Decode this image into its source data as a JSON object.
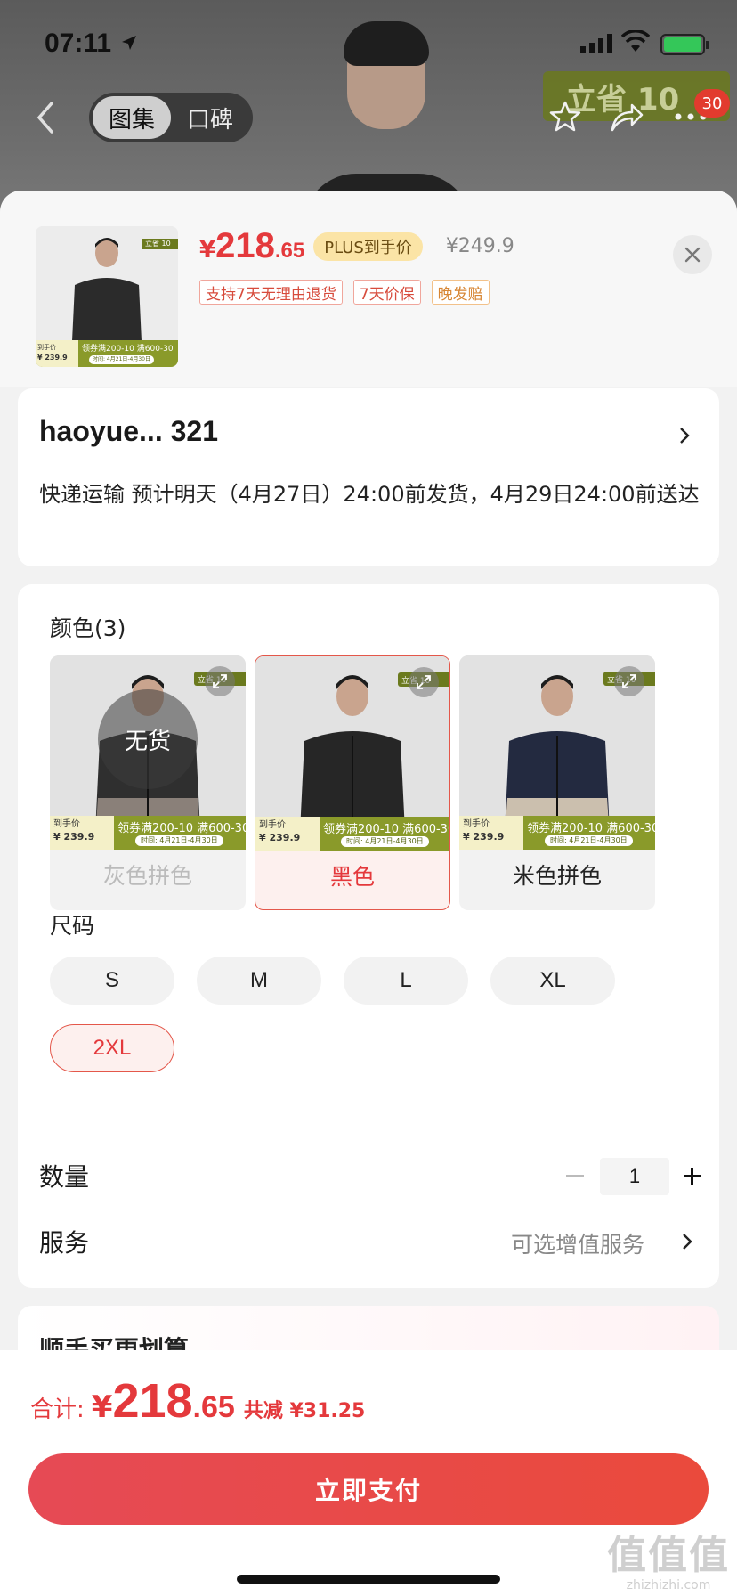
{
  "status_bar": {
    "time": "07:11"
  },
  "nav": {
    "tabs": [
      {
        "label": "图集",
        "active": true
      },
      {
        "label": "口碑",
        "active": false
      }
    ],
    "promo_badge": "立省 10",
    "notification_count": "30"
  },
  "product": {
    "thumb_price_label": "到手价",
    "thumb_price": "¥ 239.9",
    "thumb_coupon": "领券满200-10 满600-30",
    "thumb_coupon_sub": "时间: 4月21日-4月30日",
    "thumb_badge": "立省 10",
    "price_symbol": "¥",
    "price_int": "218",
    "price_dec": ".65",
    "plus_tag": "PLUS到手价",
    "original_price": "¥249.9",
    "service_tags": [
      {
        "label": "支持7天无理由退货",
        "style": "red"
      },
      {
        "label": "7天价保",
        "style": "red"
      },
      {
        "label": "晚发赔",
        "style": "orange"
      }
    ]
  },
  "address": {
    "name": "haoyue...  321",
    "shipping": "快递运输 预计明天（4月27日）24:00前发货，4月29日24:00前送达"
  },
  "color_section": {
    "title": "颜色(3)",
    "options": [
      {
        "label": "灰色拼色",
        "state": "disabled",
        "overlay": "无货",
        "jacket": "#2f2f2f",
        "lower": "#8a8079"
      },
      {
        "label": "黑色",
        "state": "selected",
        "overlay": "",
        "jacket": "#262626",
        "lower": "#262626"
      },
      {
        "label": "米色拼色",
        "state": "normal",
        "overlay": "",
        "jacket": "#232a40",
        "lower": "#cbbfae"
      }
    ],
    "badge": "立省 10",
    "price_label": "到手价",
    "price": "¥ 239.9",
    "coupon": "领券满200-10 满600-30",
    "coupon_sub": "时间: 4月21日-4月30日"
  },
  "size_section": {
    "title": "尺码",
    "options": [
      {
        "label": "S",
        "selected": false
      },
      {
        "label": "M",
        "selected": false
      },
      {
        "label": "L",
        "selected": false
      },
      {
        "label": "XL",
        "selected": false
      },
      {
        "label": "2XL",
        "selected": true
      }
    ]
  },
  "quantity": {
    "label": "数量",
    "value": "1"
  },
  "service": {
    "label": "服务",
    "value": "可选增值服务"
  },
  "promo": {
    "title": "顺手买更划算"
  },
  "footer": {
    "total_label": "合计:",
    "total_symbol": "¥",
    "total_int": "218",
    "total_dec": ".65",
    "discount": "共减 ¥31.25",
    "pay_button": "立即支付"
  },
  "watermark": {
    "logo": "值值值",
    "site": "zhizhizhi.com"
  },
  "colors": {
    "accent": "#e4393c",
    "promo_green": "#6b7a1e",
    "plus_gold": "#fbe4a6"
  }
}
